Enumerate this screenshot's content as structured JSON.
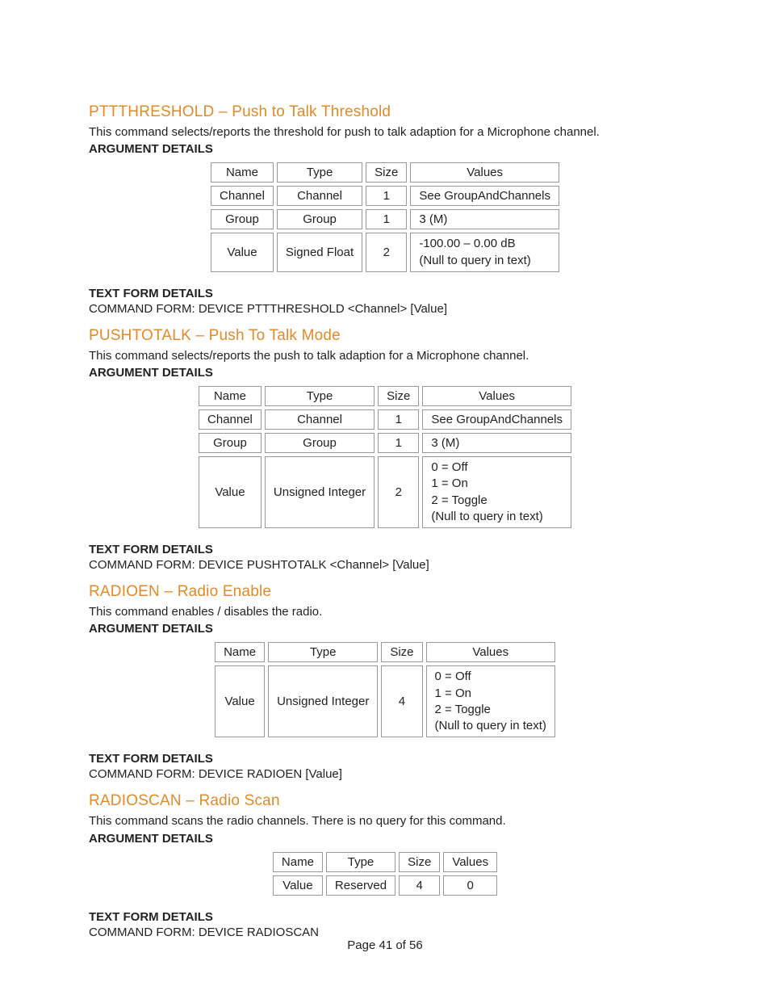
{
  "page_number": "Page 41 of 56",
  "table_headers": {
    "name": "Name",
    "type": "Type",
    "size": "Size",
    "values": "Values"
  },
  "labels": {
    "arg": "ARGUMENT DETAILS",
    "text_form": "TEXT FORM DETAILS"
  },
  "sections": [
    {
      "title": "PTTTHRESHOLD – Push to Talk Threshold",
      "desc": "This command selects/reports the threshold for push to talk adaption for a Microphone channel.",
      "rows": [
        {
          "name": "Channel",
          "type": "Channel",
          "size": "1",
          "values": "See GroupAndChannels"
        },
        {
          "name": "Group",
          "type": "Group",
          "size": "1",
          "values": "3 (M)"
        },
        {
          "name": "Value",
          "type": "Signed Float",
          "size": "2",
          "values": "-100.00 – 0.00 dB\n(Null to query in text)"
        }
      ],
      "form": "COMMAND FORM: DEVICE PTTTHRESHOLD <Channel> [Value]"
    },
    {
      "title": "PUSHTOTALK – Push To Talk Mode",
      "desc": "This command selects/reports the push to talk adaption for a Microphone channel.",
      "rows": [
        {
          "name": "Channel",
          "type": "Channel",
          "size": "1",
          "values": "See GroupAndChannels"
        },
        {
          "name": "Group",
          "type": "Group",
          "size": "1",
          "values": "3 (M)"
        },
        {
          "name": "Value",
          "type": "Unsigned Integer",
          "size": "2",
          "values": "0 = Off\n1 = On\n2 = Toggle\n(Null to query in text)"
        }
      ],
      "form": "COMMAND FORM: DEVICE PUSHTOTALK <Channel> [Value]"
    },
    {
      "title": "RADIOEN – Radio Enable",
      "desc": "This command enables / disables the radio.",
      "rows": [
        {
          "name": "Value",
          "type": "Unsigned Integer",
          "size": "4",
          "values": "0 = Off\n1 = On\n2 = Toggle\n(Null to query in text)"
        }
      ],
      "form": "COMMAND FORM: DEVICE RADIOEN [Value]"
    },
    {
      "title": "RADIOSCAN – Radio Scan",
      "desc": "This command scans the radio channels. There is no query for this command.",
      "rows": [
        {
          "name": "Value",
          "type": "Reserved",
          "size": "4",
          "values": "0"
        }
      ],
      "form": "COMMAND FORM: DEVICE RADIOSCAN"
    }
  ]
}
